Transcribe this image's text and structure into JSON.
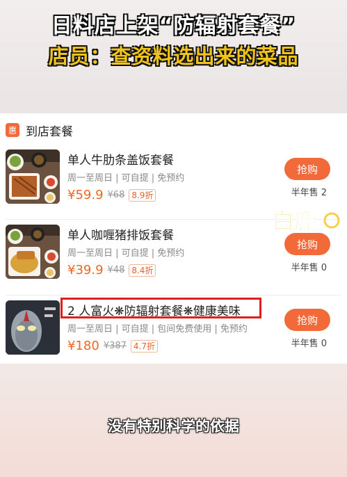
{
  "overlay": {
    "headline": "日料店上架“防辐射套餐”",
    "subheadline": "店员：查资料选出来的菜品",
    "caption": "没有特别科学的依据",
    "watermark": "白鹿"
  },
  "section": {
    "badge": "惠",
    "title": "到店套餐"
  },
  "items": [
    {
      "name": "单人牛肋条盖饭套餐",
      "meta": "周一至周日 | 可自提 | 免预约",
      "price": "¥59.9",
      "original_price": "¥68",
      "discount": "8.9折",
      "button": "抢购",
      "sold": "半年售 2",
      "thumb_icon": "beef-rice-set-image"
    },
    {
      "name": "单人咖喱猪排饭套餐",
      "meta": "周一至周日 | 可自提 | 免预约",
      "price": "¥39.9",
      "original_price": "¥48",
      "discount": "8.4折",
      "button": "抢购",
      "sold": "半年售 0",
      "thumb_icon": "curry-pork-rice-set-image"
    },
    {
      "name": "2 人富火❋防辐射套餐❋健康美味",
      "meta": "周一至周日 | 可自提 | 包间免费使用 | 免预约",
      "price": "¥180",
      "original_price": "¥387",
      "discount": "4.7折",
      "button": "抢购",
      "sold": "半年售 0",
      "thumb_icon": "ultraman-image"
    }
  ],
  "colors": {
    "accent": "#f26a3a",
    "highlight": "#e11e1e",
    "headline_yellow": "#f2c318"
  }
}
